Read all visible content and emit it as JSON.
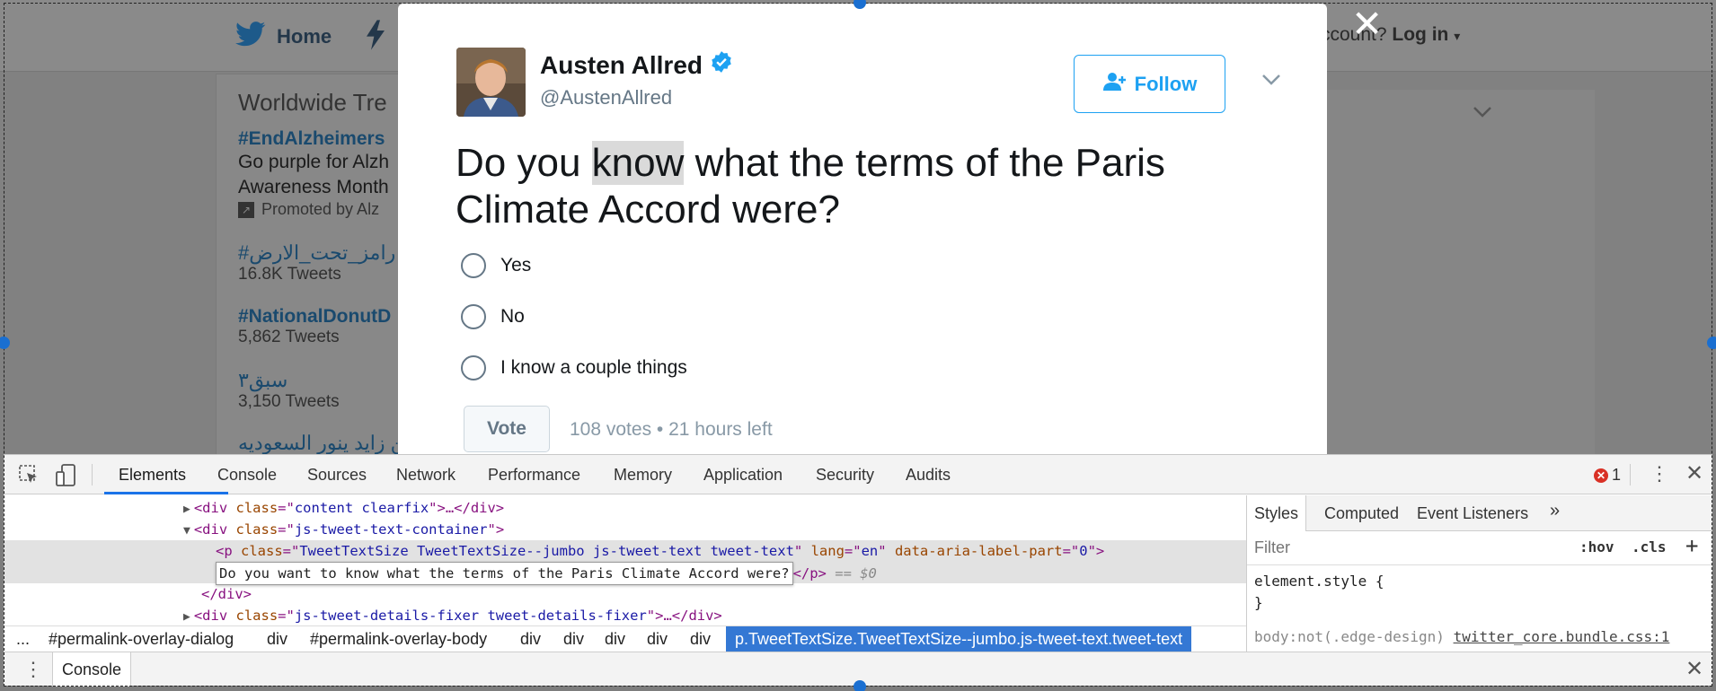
{
  "background": {
    "nav": {
      "home_label": "Home",
      "account_text": "ccount?",
      "login_label": "Log in"
    },
    "trends": {
      "title": "Worldwide Tre",
      "items": [
        {
          "name": "#EndAlzheimers",
          "desc1": "Go purple for Alzh",
          "desc2": "Awareness Month",
          "promoted": "Promoted by Alz"
        },
        {
          "name": "#رامز_تحت_الارض",
          "count": "16.8K Tweets"
        },
        {
          "name": "#NationalDonutD",
          "count": "5,862 Tweets"
        },
        {
          "name": "سبق٣",
          "count": "3,150 Tweets"
        },
        {
          "name": "ين زايد ينور السعوديه"
        }
      ]
    }
  },
  "tweet": {
    "author_name": "Austen Allred",
    "handle": "@AustenAllred",
    "follow_label": "Follow",
    "text_before": "Do you ",
    "text_highlight": "know",
    "text_after": " what the terms of the Paris Climate Accord were?",
    "poll_options": [
      "Yes",
      "No",
      "I know a couple things"
    ],
    "vote_label": "Vote",
    "vote_meta": "108 votes • 21 hours left"
  },
  "devtools": {
    "tabs": [
      "Elements",
      "Console",
      "Sources",
      "Network",
      "Performance",
      "Memory",
      "Application",
      "Security",
      "Audits"
    ],
    "error_count": "1",
    "dom": {
      "line1": {
        "tag_open": "<div ",
        "attr": "class",
        "eq": "=\"",
        "val": "content clearfix",
        "rest": "\">…</div>"
      },
      "line2": {
        "tag_open": "<div ",
        "attr": "class",
        "eq": "=\"",
        "val": "js-tweet-text-container",
        "rest": "\">"
      },
      "line3": {
        "tag_open": "<p ",
        "attr1": "class",
        "val1": "TweetTextSize TweetTextSize--jumbo js-tweet-text tweet-text",
        "attr2": "lang",
        "val2": "en",
        "attr3": "data-aria-label-part",
        "val3": "0",
        "close": "\">"
      },
      "line4": {
        "edit_text": "Do you want to know what the terms of the Paris Climate Accord were?",
        "close_tag": "</p>",
        "eq_text": "== $0"
      },
      "line5": {
        "text": "</div>"
      },
      "line6": {
        "tag_open": "<div ",
        "attr": "class",
        "eq": "=\"",
        "val": "js-tweet-details-fixer tweet-details-fixer",
        "rest": "\">…</div>"
      }
    },
    "breadcrumbs": [
      "...",
      "#permalink-overlay-dialog",
      "div",
      "#permalink-overlay-body",
      "div",
      "div",
      "div",
      "div",
      "div",
      "p.TweetTextSize.TweetTextSize--jumbo.js-tweet-text.tweet-text"
    ],
    "styles": {
      "tabs": [
        "Styles",
        "Computed",
        "Event Listeners",
        "»"
      ],
      "filter_placeholder": "Filter",
      "hov": ":hov",
      "cls": ".cls",
      "add": "+",
      "rule1": "element.style {",
      "rule1_close": "}",
      "rule2_selector": "body:not(.edge-design)",
      "rule2_source": "twitter_core.bundle.css:1"
    },
    "drawer_tab": "Console"
  }
}
